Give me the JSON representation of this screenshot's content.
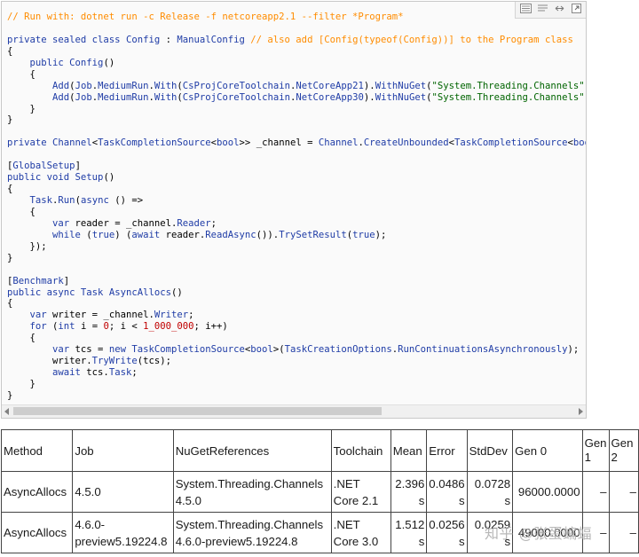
{
  "code": {
    "lines": [
      [
        [
          "c",
          "// Run with: dotnet run -c Release -f netcoreapp2.1 --filter *Program*"
        ]
      ],
      [
        [
          "p",
          ""
        ]
      ],
      [
        [
          "k",
          "private sealed class "
        ],
        [
          "t",
          "Config"
        ],
        [
          "p",
          " : "
        ],
        [
          "t",
          "ManualConfig"
        ],
        [
          "c",
          " // also add [Config(typeof(Config))] to the Program class"
        ]
      ],
      [
        [
          "p",
          "{"
        ]
      ],
      [
        [
          "p",
          "    "
        ],
        [
          "k",
          "public "
        ],
        [
          "t",
          "Config"
        ],
        [
          "p",
          "()"
        ]
      ],
      [
        [
          "p",
          "    {"
        ]
      ],
      [
        [
          "p",
          "        "
        ],
        [
          "m",
          "Add"
        ],
        [
          "p",
          "("
        ],
        [
          "t",
          "Job"
        ],
        [
          "p",
          "."
        ],
        [
          "t",
          "MediumRun"
        ],
        [
          "p",
          "."
        ],
        [
          "m",
          "With"
        ],
        [
          "p",
          "("
        ],
        [
          "t",
          "CsProjCoreToolchain"
        ],
        [
          "p",
          "."
        ],
        [
          "t",
          "NetCoreApp21"
        ],
        [
          "p",
          ")."
        ],
        [
          "m",
          "WithNuGet"
        ],
        [
          "p",
          "("
        ],
        [
          "s",
          "\"System.Threading.Channels\", \""
        ]
      ],
      [
        [
          "p",
          "        "
        ],
        [
          "m",
          "Add"
        ],
        [
          "p",
          "("
        ],
        [
          "t",
          "Job"
        ],
        [
          "p",
          "."
        ],
        [
          "t",
          "MediumRun"
        ],
        [
          "p",
          "."
        ],
        [
          "m",
          "With"
        ],
        [
          "p",
          "("
        ],
        [
          "t",
          "CsProjCoreToolchain"
        ],
        [
          "p",
          "."
        ],
        [
          "t",
          "NetCoreApp30"
        ],
        [
          "p",
          ")."
        ],
        [
          "m",
          "WithNuGet"
        ],
        [
          "p",
          "("
        ],
        [
          "s",
          "\"System.Threading.Channels\", \""
        ]
      ],
      [
        [
          "p",
          "    }"
        ]
      ],
      [
        [
          "p",
          "}"
        ]
      ],
      [
        [
          "p",
          ""
        ]
      ],
      [
        [
          "k",
          "private "
        ],
        [
          "t",
          "Channel"
        ],
        [
          "p",
          "<"
        ],
        [
          "t",
          "TaskCompletionSource"
        ],
        [
          "p",
          "<"
        ],
        [
          "k",
          "bool"
        ],
        [
          "p",
          ">> "
        ],
        [
          "p",
          "_channel = "
        ],
        [
          "t",
          "Channel"
        ],
        [
          "p",
          "."
        ],
        [
          "m",
          "CreateUnbounded"
        ],
        [
          "p",
          "<"
        ],
        [
          "t",
          "TaskCompletionSource"
        ],
        [
          "p",
          "<"
        ],
        [
          "k",
          "bool"
        ],
        [
          "p",
          ">"
        ]
      ],
      [
        [
          "p",
          ""
        ]
      ],
      [
        [
          "p",
          "["
        ],
        [
          "t",
          "GlobalSetup"
        ],
        [
          "p",
          "]"
        ]
      ],
      [
        [
          "k",
          "public void "
        ],
        [
          "m",
          "Setup"
        ],
        [
          "p",
          "()"
        ]
      ],
      [
        [
          "p",
          "{"
        ]
      ],
      [
        [
          "p",
          "    "
        ],
        [
          "t",
          "Task"
        ],
        [
          "p",
          "."
        ],
        [
          "m",
          "Run"
        ],
        [
          "p",
          "("
        ],
        [
          "k",
          "async"
        ],
        [
          "p",
          " () =>"
        ]
      ],
      [
        [
          "p",
          "    {"
        ]
      ],
      [
        [
          "p",
          "        "
        ],
        [
          "k",
          "var"
        ],
        [
          "p",
          " reader = _channel."
        ],
        [
          "t",
          "Reader"
        ],
        [
          "p",
          ";"
        ]
      ],
      [
        [
          "p",
          "        "
        ],
        [
          "k",
          "while"
        ],
        [
          "p",
          " ("
        ],
        [
          "k",
          "true"
        ],
        [
          "p",
          ") ("
        ],
        [
          "k",
          "await"
        ],
        [
          "p",
          " reader."
        ],
        [
          "m",
          "ReadAsync"
        ],
        [
          "p",
          "())."
        ],
        [
          "m",
          "TrySetResult"
        ],
        [
          "p",
          "("
        ],
        [
          "k",
          "true"
        ],
        [
          "p",
          ");"
        ]
      ],
      [
        [
          "p",
          "    });"
        ]
      ],
      [
        [
          "p",
          "}"
        ]
      ],
      [
        [
          "p",
          ""
        ]
      ],
      [
        [
          "p",
          "["
        ],
        [
          "t",
          "Benchmark"
        ],
        [
          "p",
          "]"
        ]
      ],
      [
        [
          "k",
          "public async "
        ],
        [
          "t",
          "Task"
        ],
        [
          "p",
          " "
        ],
        [
          "m",
          "AsyncAllocs"
        ],
        [
          "p",
          "()"
        ]
      ],
      [
        [
          "p",
          "{"
        ]
      ],
      [
        [
          "p",
          "    "
        ],
        [
          "k",
          "var"
        ],
        [
          "p",
          " writer = _channel."
        ],
        [
          "t",
          "Writer"
        ],
        [
          "p",
          ";"
        ]
      ],
      [
        [
          "p",
          "    "
        ],
        [
          "k",
          "for"
        ],
        [
          "p",
          " ("
        ],
        [
          "k",
          "int"
        ],
        [
          "p",
          " i = "
        ],
        [
          "n",
          "0"
        ],
        [
          "p",
          "; i < "
        ],
        [
          "n",
          "1_000_000"
        ],
        [
          "p",
          "; i++)"
        ]
      ],
      [
        [
          "p",
          "    {"
        ]
      ],
      [
        [
          "p",
          "        "
        ],
        [
          "k",
          "var"
        ],
        [
          "p",
          " tcs = "
        ],
        [
          "k",
          "new "
        ],
        [
          "t",
          "TaskCompletionSource"
        ],
        [
          "p",
          "<"
        ],
        [
          "k",
          "bool"
        ],
        [
          "p",
          ">("
        ],
        [
          "t",
          "TaskCreationOptions"
        ],
        [
          "p",
          "."
        ],
        [
          "t",
          "RunContinuationsAsynchronously"
        ],
        [
          "p",
          ");"
        ]
      ],
      [
        [
          "p",
          "        writer."
        ],
        [
          "m",
          "TryWrite"
        ],
        [
          "p",
          "(tcs);"
        ]
      ],
      [
        [
          "p",
          "        "
        ],
        [
          "k",
          "await"
        ],
        [
          "p",
          " tcs."
        ],
        [
          "t",
          "Task"
        ],
        [
          "p",
          ";"
        ]
      ],
      [
        [
          "p",
          "    }"
        ]
      ],
      [
        [
          "p",
          "}"
        ]
      ]
    ]
  },
  "toolbar": {
    "icons": [
      "view-source-icon",
      "copy-icon",
      "wrap-toggle-icon",
      "open-new-window-icon"
    ]
  },
  "table": {
    "headers": {
      "method": "Method",
      "job": "Job",
      "nuget": "NuGetReferences",
      "toolchain": "Toolchain",
      "mean": "Mean",
      "error": "Error",
      "stddev": "StdDev",
      "gen0": "Gen 0",
      "gen1": "Gen 1",
      "gen2": "Gen 2"
    },
    "rows": [
      {
        "method": "AsyncAllocs",
        "job": "4.5.0",
        "nuget": "System.Threading.Channels 4.5.0",
        "toolchain": ".NET Core 2.1",
        "mean": "2.396 s",
        "error": "0.0486 s",
        "stddev": "0.0728 s",
        "gen0": "96000.0000",
        "gen1": "–",
        "gen2": "–"
      },
      {
        "method": "AsyncAllocs",
        "job": "4.6.0-preview5.19224.8",
        "nuget": "System.Threading.Channels 4.6.0-preview5.19224.8",
        "toolchain": ".NET Core 3.0",
        "mean": "1.512 s",
        "error": "0.0256 s",
        "stddev": "0.0259 s",
        "gen0": "49000.0000",
        "gen1": "–",
        "gen2": "–"
      }
    ]
  },
  "watermark": "知乎 @张蛋蝙蝠"
}
